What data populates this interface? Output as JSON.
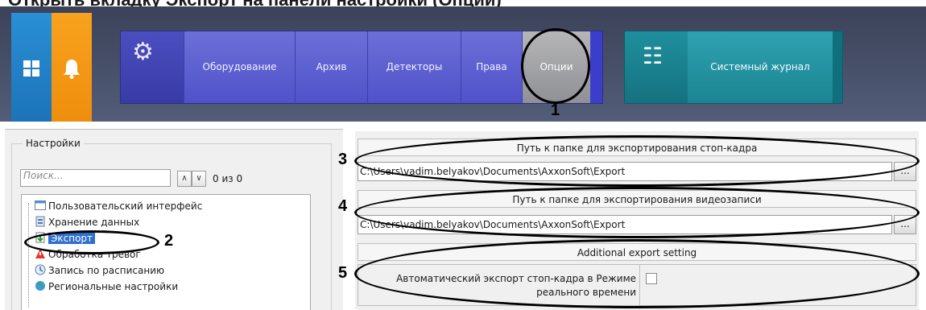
{
  "heading_cut": "Открыть вкладку Экспорт на панели настройки (Опции)",
  "sidebar_tiles": {
    "windows_icon": "windows-grid-icon",
    "bell_icon": "bell-icon",
    "windows_color": "#1f7fc8",
    "bell_color": "#f39a12"
  },
  "nav": {
    "gear_icon": "gear-icon",
    "items": [
      "Оборудование",
      "Архив",
      "Детекторы",
      "Права",
      "Опции"
    ],
    "accent": "#5558cf",
    "selected": "Опции"
  },
  "journal": {
    "icon": "journal-icon",
    "label": "Системный журнал",
    "accent": "#1b8c9b"
  },
  "settings": {
    "title": "Настройки",
    "search_placeholder": "Поиск...",
    "search_count": "0 из 0",
    "up_arrow": "∧",
    "down_arrow": "∨",
    "tree": [
      "Пользовательский интерфейс",
      "Хранение данных",
      "Экспорт",
      "Обработка тревог",
      "Запись по расписанию",
      "Региональные настройки"
    ],
    "selected_item": "Экспорт"
  },
  "export": {
    "snapshot_header": "Путь к папке для экспортирования стоп-кадра",
    "snapshot_path": "C:\\Users\\vadim.belyakov\\Documents\\AxxonSoft\\Export",
    "video_header": "Путь к папке для экспортирования видеозаписи",
    "video_path": "C:\\Users\\vadim.belyakov\\Documents\\AxxonSoft\\Export",
    "browse_label": "...",
    "additional_header": "Additional export setting",
    "auto_export_label_1": "Автоматический экспорт стоп-кадра в Режиме",
    "auto_export_label_2": "реального времени",
    "auto_export_checked": false
  },
  "annotations": [
    "1",
    "2",
    "3",
    "4",
    "5"
  ]
}
